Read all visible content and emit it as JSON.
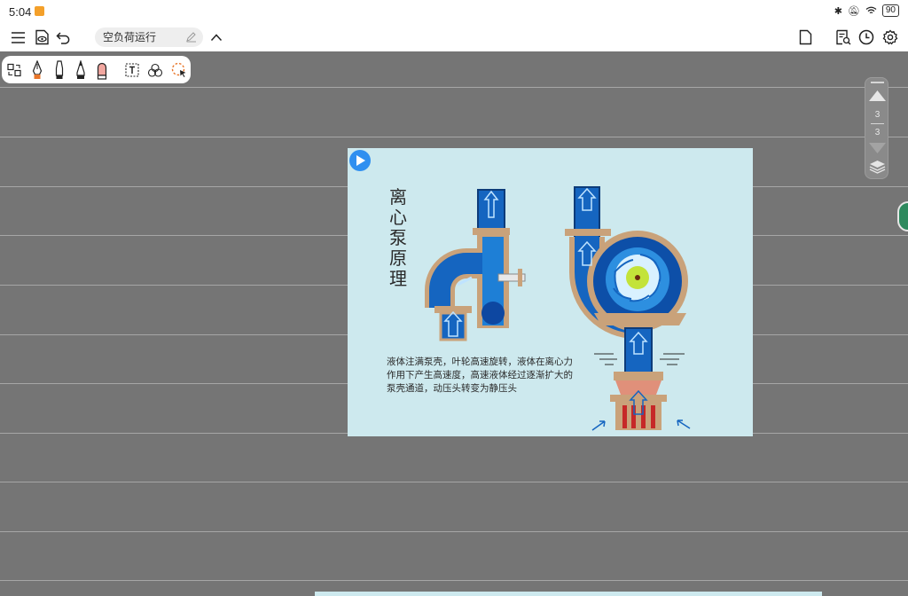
{
  "status": {
    "time": "5:04",
    "battery": "90"
  },
  "header": {
    "doc_title": "空负荷运行"
  },
  "page_nav": {
    "current": "3",
    "total": "3"
  },
  "slide": {
    "title": "离心泵原理",
    "caption": "液体注满泵壳，叶轮高速旋转，液体在离心力作用下产生高速度，高速液体经过逐渐扩大的泵壳通道，动压头转变为静压头"
  },
  "colors": {
    "background": "#757575",
    "slide_bg": "#cde9ee",
    "pipe_blue": "#1565c0",
    "pump_tan": "#c9a27a",
    "accent_orange": "#e8762a"
  }
}
